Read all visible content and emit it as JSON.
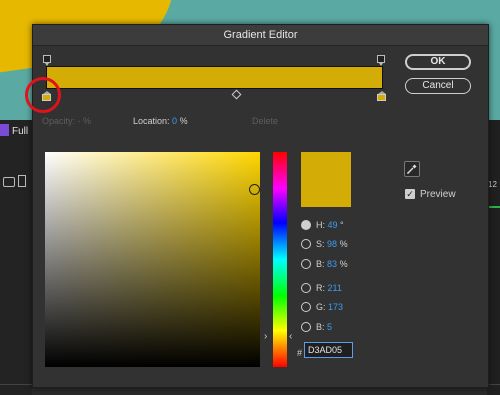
{
  "background": {
    "left_label": "Full",
    "right_text": "12"
  },
  "dialog": {
    "title": "Gradient Editor",
    "ok_label": "OK",
    "cancel_label": "Cancel",
    "opacity_label": "Opacity:",
    "opacity_value": "-",
    "opacity_unit": "%",
    "location_label": "Location:",
    "location_value": "0",
    "location_unit": "%",
    "delete_label": "Delete",
    "preview_label": "Preview",
    "preview_checked": true
  },
  "color": {
    "accent_color": "#d3ad05",
    "highlight_color": "#e0121a",
    "fields": {
      "h": {
        "label": "H:",
        "value": "49",
        "unit": "°",
        "selected": true
      },
      "s": {
        "label": "S:",
        "value": "98",
        "unit": "%"
      },
      "b_hsb": {
        "label": "B:",
        "value": "83",
        "unit": "%"
      },
      "r": {
        "label": "R:",
        "value": "211"
      },
      "g": {
        "label": "G:",
        "value": "173"
      },
      "b_rgb": {
        "label": "B:",
        "value": "5"
      }
    },
    "hex_prefix": "#",
    "hex": "D3AD05"
  },
  "icons": [
    "eyedropper-icon",
    "checkmark-icon",
    "hue-slider-arrow-icon"
  ]
}
